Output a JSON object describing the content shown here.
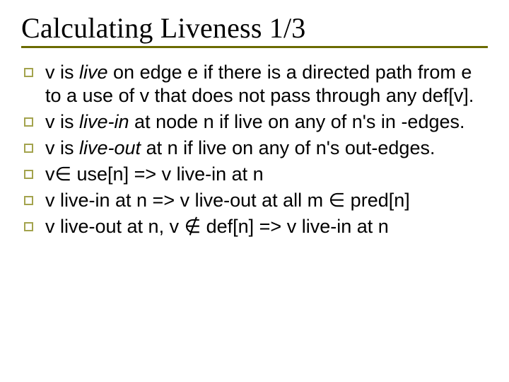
{
  "slide": {
    "title": "Calculating Liveness 1/3",
    "bullets": [
      {
        "pre1": "v is ",
        "em1": "live",
        "post1": " on edge e if there is a directed path from e to a use of v that does not pass through any def[v]."
      },
      {
        "pre1": "v is ",
        "em1": "live-in",
        "post1": " at node n if live on any of n's in -edges."
      },
      {
        "pre1": "v is ",
        "em1": "live-out",
        "post1": " at n if live on any of n's out-edges."
      },
      {
        "pre1": "v∈ use[n] => v live-in at n",
        "em1": "",
        "post1": ""
      },
      {
        "pre1": "v live-in at n => v live-out at all m ∈ pred[n]",
        "em1": "",
        "post1": ""
      },
      {
        "pre1": "v live-out at n, v ∉ def[n]  => v live-in at n",
        "em1": "",
        "post1": ""
      }
    ]
  }
}
